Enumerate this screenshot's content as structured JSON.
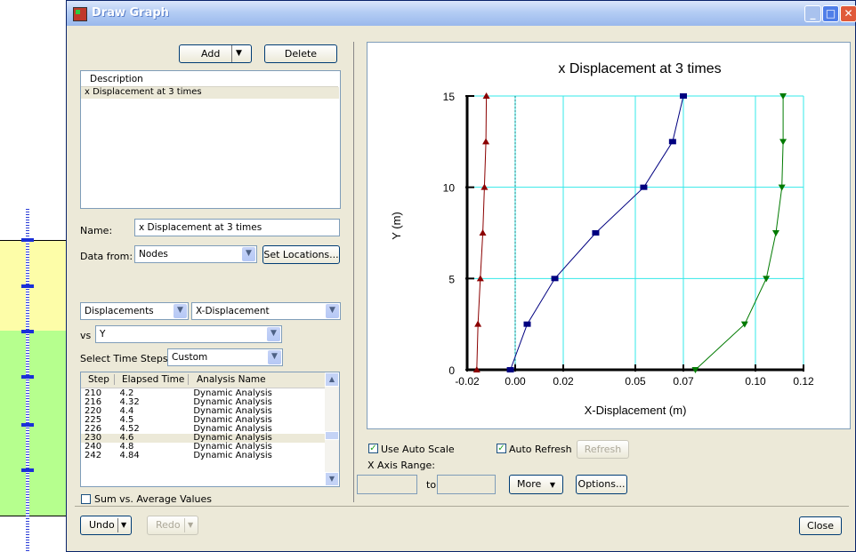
{
  "window": {
    "title": "Draw Graph",
    "controls": [
      "minimize-icon",
      "maximize-icon",
      "close-icon"
    ]
  },
  "left": {
    "add_label": "Add",
    "delete_label": "Delete",
    "description_header": "Description",
    "graph_items": [
      "x Displacement at 3 times"
    ],
    "name_label": "Name:",
    "name_value": "x Displacement at 3 times",
    "data_from_label": "Data from:",
    "data_from_value": "Nodes",
    "set_locations_label": "Set Locations...",
    "quantity_value": "Displacements",
    "component_value": "X-Displacement",
    "vs_label": "vs",
    "vs_value": "Y",
    "time_steps_label": "Select Time Steps:",
    "time_steps_value": "Custom",
    "steps_headers": [
      "Step",
      "Elapsed Time",
      "Analysis Name"
    ],
    "steps_rows": [
      [
        "210",
        "4.2",
        "Dynamic Analysis"
      ],
      [
        "216",
        "4.32",
        "Dynamic Analysis"
      ],
      [
        "220",
        "4.4",
        "Dynamic Analysis"
      ],
      [
        "225",
        "4.5",
        "Dynamic Analysis"
      ],
      [
        "226",
        "4.52",
        "Dynamic Analysis"
      ],
      [
        "230",
        "4.6",
        "Dynamic Analysis"
      ],
      [
        "240",
        "4.8",
        "Dynamic Analysis"
      ],
      [
        "242",
        "4.84",
        "Dynamic Analysis"
      ]
    ],
    "sum_vs_average_label": "Sum vs. Average Values"
  },
  "bottom": {
    "undo_label": "Undo",
    "redo_label": "Redo",
    "close_label": "Close"
  },
  "graph_controls": {
    "use_auto_scale_label": "Use Auto Scale",
    "auto_refresh_label": "Auto Refresh",
    "refresh_label": "Refresh",
    "x_axis_range_label": "X Axis Range:",
    "to_label": "to",
    "more_label": "More",
    "options_label": "Options..."
  },
  "colors": {
    "grid": "#33e8e8",
    "series_red": "#8b0000",
    "series_blue": "#000080",
    "series_green": "#007a00",
    "selection": "#ece9d8"
  },
  "chart_data": {
    "type": "line",
    "title": "x Displacement at 3 times",
    "xlabel": "X-Displacement (m)",
    "ylabel": "Y (m)",
    "xlim": [
      -0.02,
      0.12
    ],
    "ylim": [
      0,
      15
    ],
    "xticks": [
      "-0.02",
      "0.00",
      "0.02",
      "0.05",
      "0.07",
      "0.10",
      "0.12"
    ],
    "yticks": [
      "0",
      "5",
      "10",
      "15"
    ],
    "grid": true,
    "series": [
      {
        "color": "#8b0000",
        "marker": "triangle-up",
        "x": [
          -0.016,
          -0.0155,
          -0.0145,
          -0.0135,
          -0.0128,
          -0.0122,
          -0.012
        ],
        "y": [
          0,
          2.5,
          5,
          7.5,
          10,
          12.5,
          15
        ]
      },
      {
        "color": "#000080",
        "marker": "square",
        "x": [
          -0.002,
          0.005,
          0.0165,
          0.0335,
          0.0535,
          0.0655,
          0.07
        ],
        "y": [
          0,
          2.5,
          5,
          7.5,
          10,
          12.5,
          15
        ]
      },
      {
        "color": "#007a00",
        "marker": "triangle-down",
        "x": [
          0.075,
          0.0955,
          0.1045,
          0.1085,
          0.111,
          0.1115,
          0.1115
        ],
        "y": [
          0,
          2.5,
          5,
          7.5,
          10,
          12.5,
          15
        ]
      }
    ],
    "reference_line": {
      "x": 0,
      "style": "dashed"
    }
  }
}
